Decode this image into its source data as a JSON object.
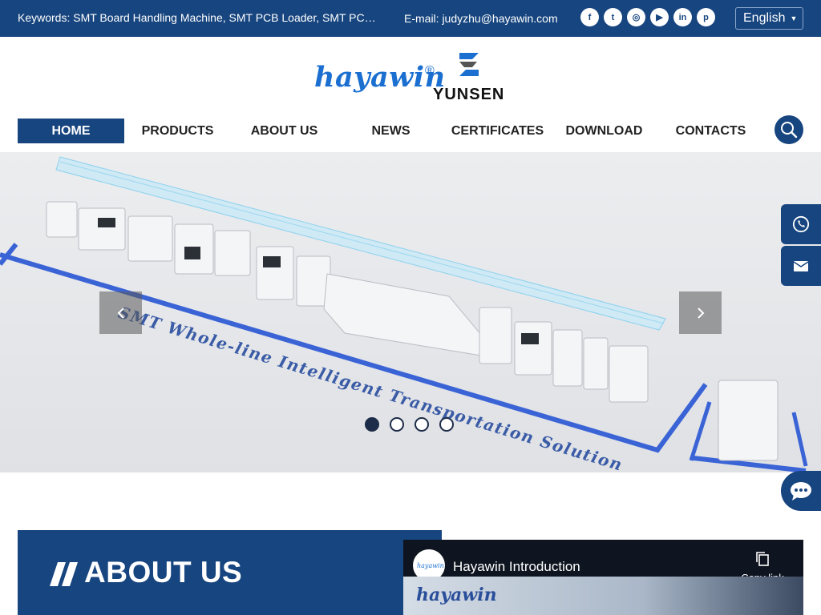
{
  "topbar": {
    "keywords": "Keywords: SMT Board Handling Machine, SMT PCB Loader, SMT PCB Conveyor, SMT PCB Unloader",
    "email": "E-mail: judyzhu@hayawin.com",
    "social": [
      {
        "icon": "facebook-icon",
        "glyph": "f"
      },
      {
        "icon": "twitter-icon",
        "glyph": "t"
      },
      {
        "icon": "instagram-icon",
        "glyph": "◎"
      },
      {
        "icon": "youtube-icon",
        "glyph": "▶"
      },
      {
        "icon": "linkedin-icon",
        "glyph": "in"
      },
      {
        "icon": "pinterest-icon",
        "glyph": "p"
      }
    ],
    "language": "English"
  },
  "brand": {
    "name": "hayawin",
    "registered": "®",
    "partner": "YUNSEN"
  },
  "nav": {
    "items": [
      {
        "label": "HOME",
        "active": true
      },
      {
        "label": "PRODUCTS",
        "active": false
      },
      {
        "label": "ABOUT US",
        "active": false
      },
      {
        "label": "NEWS",
        "active": false
      },
      {
        "label": "CERTIFICATES",
        "active": false
      },
      {
        "label": "DOWNLOAD",
        "active": false
      },
      {
        "label": "CONTACTS",
        "active": false
      }
    ]
  },
  "banner": {
    "caption": "SMT Whole-line Intelligent Transportation Solution",
    "slide_count": 4,
    "active_slide": 1
  },
  "about": {
    "title": "ABOUT US"
  },
  "video": {
    "title": "Hayawin Introduction",
    "copy_label": "Copy link",
    "frame_brand": "hayawin"
  },
  "colors": {
    "primary": "#17457f",
    "brand_blue": "#1a6fd0"
  }
}
